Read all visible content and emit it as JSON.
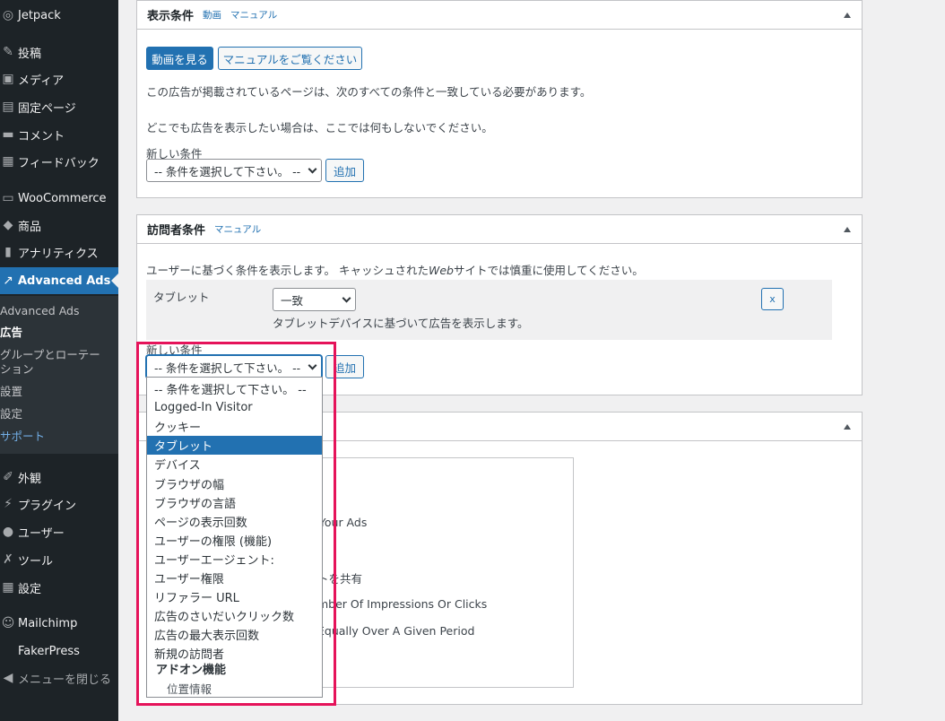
{
  "sidebar": {
    "items": [
      {
        "label": "Jetpack",
        "icon": "jetpack-icon",
        "glyph": "◎"
      },
      {
        "label": "投稿",
        "icon": "pin-icon",
        "glyph": "✎"
      },
      {
        "label": "メディア",
        "icon": "media-icon",
        "glyph": "▣"
      },
      {
        "label": "固定ページ",
        "icon": "page-icon",
        "glyph": "▤"
      },
      {
        "label": "コメント",
        "icon": "comment-icon",
        "glyph": "▬"
      },
      {
        "label": "フィードバック",
        "icon": "feedback-icon",
        "glyph": "▦"
      },
      {
        "label": "WooCommerce",
        "icon": "woocommerce-icon",
        "glyph": "▭"
      },
      {
        "label": "商品",
        "icon": "product-icon",
        "glyph": "◆"
      },
      {
        "label": "アナリティクス",
        "icon": "analytics-icon",
        "glyph": "▮"
      },
      {
        "label": "Advanced Ads",
        "icon": "advanced-ads-icon",
        "glyph": "↗"
      },
      {
        "label": "外観",
        "icon": "appearance-icon",
        "glyph": "✐"
      },
      {
        "label": "プラグイン",
        "icon": "plugin-icon",
        "glyph": "⚡"
      },
      {
        "label": "ユーザー",
        "icon": "user-icon",
        "glyph": "●"
      },
      {
        "label": "ツール",
        "icon": "tool-icon",
        "glyph": "✗"
      },
      {
        "label": "設定",
        "icon": "settings-icon",
        "glyph": "▦"
      },
      {
        "label": "Mailchimp",
        "icon": "mailchimp-icon",
        "glyph": "☺"
      },
      {
        "label": "FakerPress",
        "icon": "fakerpress-icon",
        "glyph": ""
      },
      {
        "label": "メニューを閉じる",
        "icon": "collapse-menu-icon",
        "glyph": "◀"
      }
    ],
    "submenu": [
      "Advanced Ads",
      "広告",
      "グループとローテーション",
      "設置",
      "設定",
      "サポート"
    ]
  },
  "display_conditions": {
    "title": "表示条件",
    "link_video": "動画",
    "link_manual": "マニュアル",
    "btn_video": "動画を見る",
    "btn_manual": "マニュアルをご覧ください",
    "text1": "この広告が掲載されているページは、次のすべての条件と一致している必要があります。",
    "text2": "どこでも広告を表示したい場合は、ここでは何もしないでください。",
    "new_condition_label": "新しい条件",
    "select_value": "-- 条件を選択して下さい。 --",
    "add_button": "追加"
  },
  "visitor_conditions": {
    "title": "訪問者条件",
    "link_manual": "マニュアル",
    "intro_prefix": "ユーザーに基づく条件を表示します。 キャッシュされた",
    "intro_web": "Web",
    "intro_suffix": "サイトでは慎重に使用してください。",
    "condition_name": "タブレット",
    "operator": "一致",
    "condition_desc": "タブレットデバイスに基づいて広告を表示します。",
    "remove_button": "x",
    "new_condition_label": "新しい条件",
    "select_value": "-- 条件を選択して下さい。 --",
    "add_button": "追加"
  },
  "dropdown": {
    "options": [
      "-- 条件を選択して下さい。 --",
      "Logged-In Visitor",
      "クッキー",
      "タブレット",
      "デバイス",
      "ブラウザの幅",
      "ブラウザの言語",
      "ページの表示回数",
      "ユーザーの権限 (機能)",
      "ユーザーエージェント:",
      "ユーザー権限",
      "リファラー URL",
      "広告のさいだいクリック数",
      "広告の最大表示回数",
      "新規の訪問者"
    ],
    "selected_option": "タブレット",
    "group_label": "アドオン機能",
    "group_option": "位置情報"
  },
  "third_panel": {
    "fragments": [
      "n Your Ads",
      "トを共有",
      "mber Of Impressions Or Clicks",
      "Equally Over A Given Period"
    ]
  },
  "colors": {
    "sidebar_bg": "#1d2327",
    "accent": "#2271b1",
    "highlight_frame": "#e5135a"
  }
}
